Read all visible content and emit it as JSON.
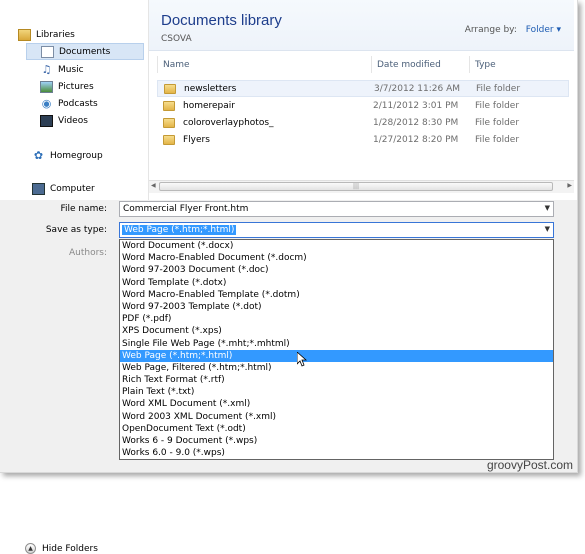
{
  "nav": {
    "items": [
      {
        "label": "Libraries",
        "icon": "libraries-icon"
      },
      {
        "label": "Documents",
        "icon": "documents-icon",
        "selected": true
      },
      {
        "label": "Music",
        "icon": "music-icon"
      },
      {
        "label": "Pictures",
        "icon": "pictures-icon"
      },
      {
        "label": "Podcasts",
        "icon": "podcasts-icon"
      },
      {
        "label": "Videos",
        "icon": "videos-icon"
      },
      {
        "label": "Homegroup",
        "icon": "homegroup-icon"
      },
      {
        "label": "Computer",
        "icon": "computer-icon"
      }
    ]
  },
  "library": {
    "title": "Documents library",
    "subtitle": "CSOVA",
    "arrange_label": "Arrange by:",
    "arrange_value": "Folder",
    "columns": {
      "name": "Name",
      "date": "Date modified",
      "type": "Type"
    },
    "rows": [
      {
        "name": "newsletters",
        "date": "3/7/2012 11:26 AM",
        "type": "File folder"
      },
      {
        "name": "homerepair",
        "date": "2/11/2012 3:01 PM",
        "type": "File folder"
      },
      {
        "name": "coloroverlayphotos_",
        "date": "1/28/2012 8:30 PM",
        "type": "File folder"
      },
      {
        "name": "Flyers",
        "date": "1/27/2012 8:20 PM",
        "type": "File folder"
      }
    ]
  },
  "form": {
    "filename_label": "File name:",
    "filename_value": "Commercial Flyer Front.htm",
    "savetype_label": "Save as type:",
    "savetype_value": "Web Page (*.htm;*.html)",
    "authors_label": "Authors:"
  },
  "type_options": [
    "Word Document (*.docx)",
    "Word Macro-Enabled Document (*.docm)",
    "Word 97-2003 Document (*.doc)",
    "Word Template (*.dotx)",
    "Word Macro-Enabled Template (*.dotm)",
    "Word 97-2003 Template (*.dot)",
    "PDF (*.pdf)",
    "XPS Document (*.xps)",
    "Single File Web Page (*.mht;*.mhtml)",
    "Web Page (*.htm;*.html)",
    "Web Page, Filtered (*.htm;*.html)",
    "Rich Text Format (*.rtf)",
    "Plain Text (*.txt)",
    "Word XML Document (*.xml)",
    "Word 2003 XML Document (*.xml)",
    "OpenDocument Text (*.odt)",
    "Works 6 - 9 Document (*.wps)",
    "Works 6.0 - 9.0 (*.wps)"
  ],
  "selected_option_index": 9,
  "hide_folders_label": "Hide Folders",
  "watermark": "groovyPost.com",
  "colors": {
    "accent": "#3399ff",
    "title": "#1e3e8c"
  }
}
